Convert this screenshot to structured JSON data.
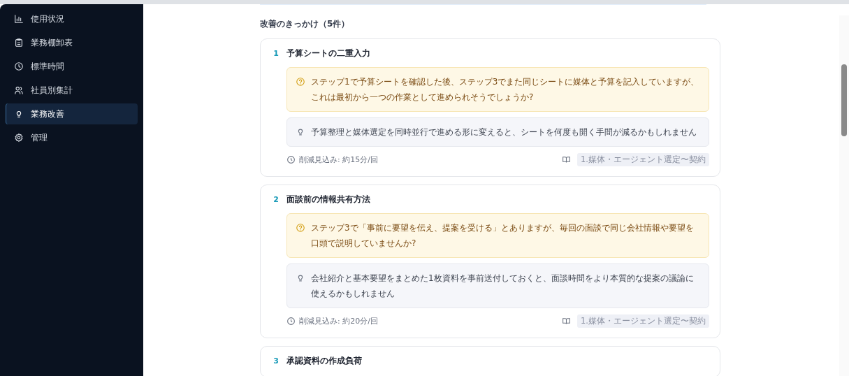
{
  "sidebar": {
    "items": [
      {
        "label": "使用状況",
        "selected": false
      },
      {
        "label": "業務棚卸表",
        "selected": false
      },
      {
        "label": "標準時間",
        "selected": false
      },
      {
        "label": "社員別集計",
        "selected": false
      },
      {
        "label": "業務改善",
        "selected": true
      },
      {
        "label": "管理",
        "selected": false
      }
    ]
  },
  "section": {
    "title": "改善のきっかけ（5件）",
    "cards": [
      {
        "number": "1",
        "title": "予算シートの二重入力",
        "question": "ステップ1で予算シートを確認した後、ステップ3でまた同じシートに媒体と予算を記入していますが、これは最初から一つの作業として進められそうでしょうか?",
        "suggestion": "予算整理と媒体選定を同時並行で進める形に変えると、シートを何度も開く手間が減るかもしれません",
        "saving": "削減見込み: 約15分/回",
        "tag": "1.媒体・エージェント選定〜契約"
      },
      {
        "number": "2",
        "title": "面談前の情報共有方法",
        "question": "ステップ3で「事前に要望を伝え、提案を受ける」とありますが、毎回の面談で同じ会社情報や要望を口頭で説明していませんか?",
        "suggestion": "会社紹介と基本要望をまとめた1枚資料を事前送付しておくと、面談時間をより本質的な提案の議論に使えるかもしれません",
        "saving": "削減見込み: 約20分/回",
        "tag": "1.媒体・エージェント選定〜契約"
      },
      {
        "number": "3",
        "title": "承認資料の作成負荷"
      }
    ]
  }
}
